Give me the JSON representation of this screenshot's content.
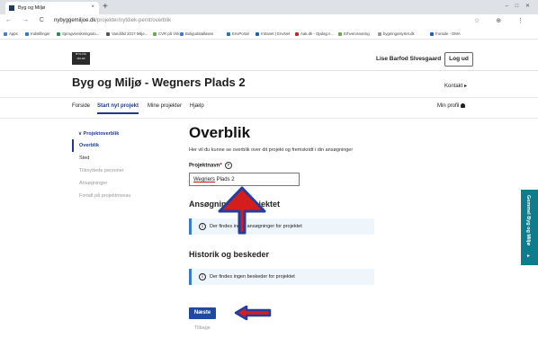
{
  "browser": {
    "tab_title": "Byg og Miljø",
    "tab_close": "×",
    "new_tab": "+",
    "window_controls": "– □ ✕",
    "nav_icons": "← → C",
    "url_host": "nybyggemiljoe.dk",
    "url_path": "/projekter/nytdiek-pernt/overblik",
    "right_icons": "☆ ⊕ ⋮",
    "bookmarks": [
      "Apps",
      "Indstillinger",
      "Sprogvenskningsdo...",
      "Vandråd 2017 Milje...",
      "CVR på Virk",
      "Boligudstallasen",
      "EnvPortal",
      "Intranet | EnvNet",
      "Aak.dk - Opdag n...",
      "Erhvervsvaring",
      "bygningsstyrtet.dk",
      "Forside - DMA"
    ]
  },
  "header": {
    "logo_text": "BYG OG MILJØ",
    "user_name": "Lise Barfod Slvesgaard",
    "logout": "Log ud"
  },
  "page": {
    "title": "Byg og Miljø - Wegners Plads 2",
    "kontakt": "Kontakt ▸"
  },
  "nav": {
    "items": [
      "Forside",
      "Start nyt projekt",
      "Mine projekter",
      "Hjælp"
    ],
    "profile": "Min profil"
  },
  "sidebar": {
    "header": "∨ Projektoverblik",
    "items": [
      "Overblik",
      "Sted",
      "Tilknyttede personer",
      "Ansøgninger",
      "Fortalt på projektniveau"
    ]
  },
  "main": {
    "heading": "Overblik",
    "intro": "Her vil du kunne se overblik over dit projekt og fremskridt i din ansøgninger",
    "project_label": "Projektnavn",
    "project_required": "*",
    "help": "?",
    "project_value_a": "Wegners",
    "project_value_b": " Plads 2",
    "section1": "Ansøgninger i projektet",
    "info1": "Der findes ingen ansøgninger for projektet",
    "section2": "Historik og beskeder",
    "info2": "Der findes ingen beskeder for projektet",
    "info_icon": "i",
    "next": "Næste",
    "back": "Tilbage"
  },
  "side_tab": {
    "label": "Gemmel Byg og Miljø",
    "arrow": "▸"
  },
  "colors": {
    "primary": "#1f4aa0",
    "teal": "#0d7c8c",
    "arrow_red": "#d41e1e",
    "arrow_blue": "#243ea0"
  }
}
